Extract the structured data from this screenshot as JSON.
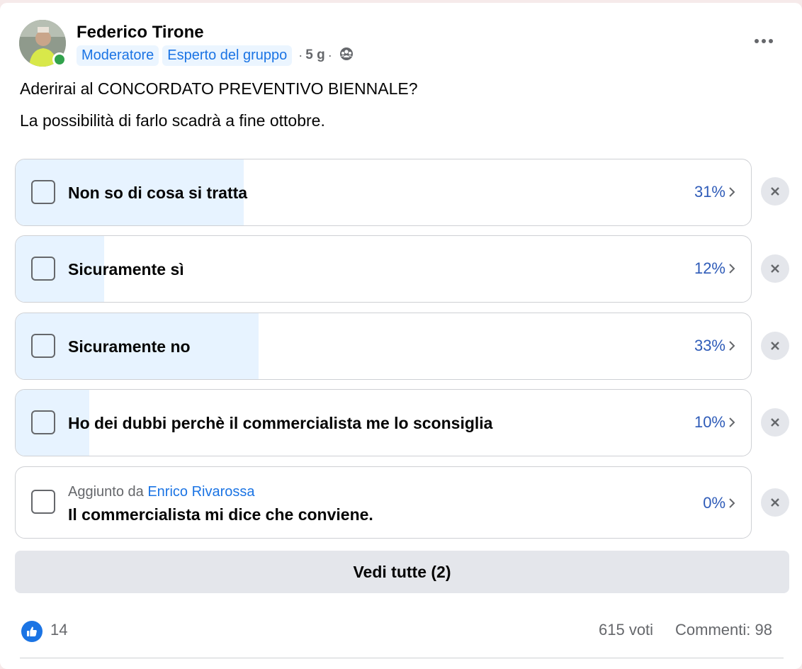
{
  "post": {
    "author": "Federico Tirone",
    "badges": [
      "Moderatore",
      "Esperto del gruppo"
    ],
    "time": "5 g",
    "meta_sep": "·",
    "privacy_icon": "group-icon",
    "text_line1": "Aderirai al CONCORDATO PREVENTIVO BIENNALE?",
    "text_line2": "La possibilità di farlo scadrà a fine ottobre."
  },
  "poll": {
    "options": [
      {
        "label": "Non so di cosa si tratta",
        "percent_text": "31%",
        "percent": 31
      },
      {
        "label": "Sicuramente sì",
        "percent_text": "12%",
        "percent": 12
      },
      {
        "label": "Sicuramente no",
        "percent_text": "33%",
        "percent": 33
      },
      {
        "label": "Ho dei dubbi perchè il commercialista me lo sconsiglia",
        "percent_text": "10%",
        "percent": 10
      },
      {
        "added_by_prefix": "Aggiunto da",
        "added_by": "Enrico Rivarossa",
        "label": "Il commercialista mi dice che conviene.",
        "percent_text": "0%",
        "percent": 0
      }
    ],
    "see_all": "Vedi tutte (2)"
  },
  "footer": {
    "likes": "14",
    "votes": "615 voti",
    "comments": "Commenti: 98"
  },
  "colors": {
    "accent": "#1b74e4",
    "bar_fill": "#e7f3ff",
    "percent": "#2e5bb8"
  }
}
